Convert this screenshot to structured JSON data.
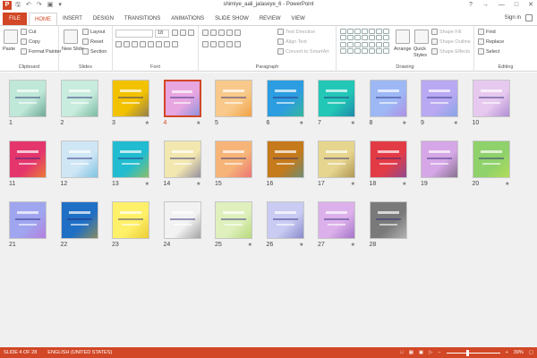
{
  "window": {
    "title": "shimiye_aali_jalaseye_6 - PowerPoint",
    "app_icon": "P",
    "qat_icons": [
      "save-icon",
      "undo-icon",
      "redo-icon",
      "present-icon",
      "customize-icon"
    ],
    "controls": [
      "?",
      "→",
      "—",
      "□",
      "✕"
    ]
  },
  "tabs": {
    "file": "FILE",
    "items": [
      "HOME",
      "INSERT",
      "DESIGN",
      "TRANSITIONS",
      "ANIMATIONS",
      "SLIDE SHOW",
      "REVIEW",
      "VIEW"
    ],
    "active": "HOME",
    "sign_in": "Sign in"
  },
  "ribbon": {
    "clipboard": {
      "label": "Clipboard",
      "paste": "Paste",
      "cut": "Cut",
      "copy": "Copy",
      "format_painter": "Format Painter"
    },
    "slides": {
      "label": "Slides",
      "new_slide": "New Slide",
      "layout": "Layout",
      "reset": "Reset",
      "section": "Section"
    },
    "font": {
      "label": "Font",
      "font_name": "",
      "font_size": "18"
    },
    "paragraph": {
      "label": "Paragraph",
      "text_direction": "Text Direction",
      "align_text": "Align Text",
      "convert_smartart": "Convert to SmartArt"
    },
    "drawing": {
      "label": "Drawing",
      "arrange": "Arrange",
      "quick_styles": "Quick Styles",
      "shape_fill": "Shape Fill",
      "shape_outline": "Shape Outline",
      "shape_effects": "Shape Effects"
    },
    "editing": {
      "label": "Editing",
      "find": "Find",
      "replace": "Replace",
      "select": "Select"
    }
  },
  "slides": [
    {
      "number": "1",
      "bg": "#bfe8d8",
      "accent": "#1f6b55",
      "star": false
    },
    {
      "number": "2",
      "bg": "#c8ecdd",
      "accent": "#2f8a6a",
      "star": false
    },
    {
      "number": "3",
      "bg": "#f2c200",
      "accent": "#3a3aa0",
      "star": true
    },
    {
      "number": "4",
      "bg": "#e7a6e0",
      "accent": "#3b7fd9",
      "star": true
    },
    {
      "number": "5",
      "bg": "#f8c98a",
      "accent": "#e87a00",
      "star": false
    },
    {
      "number": "6",
      "bg": "#2c9de0",
      "accent": "#3ed15a",
      "star": true
    },
    {
      "number": "7",
      "bg": "#22c7b6",
      "accent": "#1a4fa0",
      "star": true
    },
    {
      "number": "8",
      "bg": "#9db8f5",
      "accent": "#c06ad4",
      "star": true
    },
    {
      "number": "9",
      "bg": "#b9a9f2",
      "accent": "#5aa0d8",
      "star": true
    },
    {
      "number": "10",
      "bg": "#e7c9ef",
      "accent": "#7b56b8",
      "star": false
    },
    {
      "number": "11",
      "bg": "#e4356d",
      "accent": "#f2c200",
      "star": false
    },
    {
      "number": "12",
      "bg": "#cfe6f5",
      "accent": "#2d9fd0",
      "star": false
    },
    {
      "number": "13",
      "bg": "#21bcd0",
      "accent": "#f2c200",
      "star": true
    },
    {
      "number": "14",
      "bg": "#f3e7b0",
      "accent": "#3a3a90",
      "star": true
    },
    {
      "number": "15",
      "bg": "#f6b479",
      "accent": "#e4356d",
      "star": false
    },
    {
      "number": "16",
      "bg": "#c57a1b",
      "accent": "#1aa0c8",
      "star": false
    },
    {
      "number": "17",
      "bg": "#e6d58e",
      "accent": "#7a5a1b",
      "star": true
    },
    {
      "number": "18",
      "bg": "#e33b46",
      "accent": "#3b5bd9",
      "star": true
    },
    {
      "number": "19",
      "bg": "#d5a7e6",
      "accent": "#3b3b3b",
      "star": false
    },
    {
      "number": "20",
      "bg": "#8fd16b",
      "accent": "#d2e84a",
      "star": true
    },
    {
      "number": "21",
      "bg": "#9fa5ee",
      "accent": "#c85ad0",
      "star": false
    },
    {
      "number": "22",
      "bg": "#1f6fc4",
      "accent": "#f2a800",
      "star": false
    },
    {
      "number": "23",
      "bg": "#fff06a",
      "accent": "#d7a800",
      "star": false
    },
    {
      "number": "24",
      "bg": "#f2f2f2",
      "accent": "#555555",
      "star": false
    },
    {
      "number": "25",
      "bg": "#dff0bd",
      "accent": "#8fc43a",
      "star": true
    },
    {
      "number": "26",
      "bg": "#c9cbf2",
      "accent": "#4a4aa8",
      "star": true
    },
    {
      "number": "27",
      "bg": "#dcb0ea",
      "accent": "#6b3ba8",
      "star": true
    },
    {
      "number": "28",
      "bg": "#7a7a7a",
      "accent": "#e9e9e9",
      "star": false
    }
  ],
  "selected_slide": "4",
  "status": {
    "slide_info": "SLIDE 4 OF 28",
    "language": "ENGLISH (UNITED STATES)",
    "zoom": "39%",
    "zoom_fraction": 0.39
  },
  "colors": {
    "accent": "#d24726"
  }
}
